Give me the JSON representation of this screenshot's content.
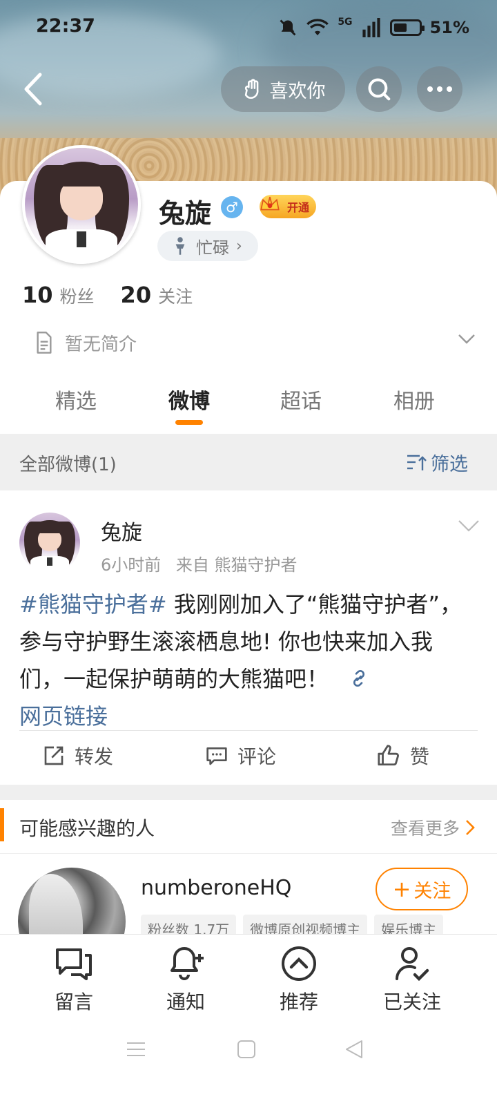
{
  "status": {
    "time": "22:37",
    "network": "5G",
    "battery": "51%"
  },
  "header": {
    "like_label": "喜欢你"
  },
  "profile": {
    "name": "兔旋",
    "gender_symbol": "♂",
    "vip_label": "开通",
    "status_label": "忙碌",
    "fans_count": "10",
    "fans_label": "粉丝",
    "following_count": "20",
    "following_label": "关注",
    "bio": "暂无简介"
  },
  "tabs": [
    "精选",
    "微博",
    "超话",
    "相册"
  ],
  "filter": {
    "label": "全部微博(1)",
    "button": "筛选"
  },
  "post": {
    "author": "兔旋",
    "time": "6小时前",
    "source": "来自 熊猫守护者",
    "hashtag": "#熊猫守护者#",
    "text": " 我刚刚加入了“熊猫守护者”，参与守护野生滚滚栖息地! 你也快来加入我们，一起保护萌萌的大熊猫吧！",
    "link_label": "网页链接",
    "repost_label": "转发",
    "comment_label": "评论",
    "like_label": "赞"
  },
  "suggest": {
    "title": "可能感兴趣的人",
    "more": "查看更多",
    "user": {
      "name": "numberoneHQ",
      "tags": [
        "粉丝数 1.7万",
        "微博原创视频博主",
        "娱乐博主"
      ],
      "follow_label": "关注"
    }
  },
  "bottom_nav": [
    {
      "label": "留言",
      "icon": "message-icon"
    },
    {
      "label": "通知",
      "icon": "bell-plus-icon"
    },
    {
      "label": "推荐",
      "icon": "chevron-up-circle-icon"
    },
    {
      "label": "已关注",
      "icon": "user-check-icon"
    }
  ],
  "colors": {
    "accent": "#ff8200",
    "link": "#4a6f9b"
  }
}
